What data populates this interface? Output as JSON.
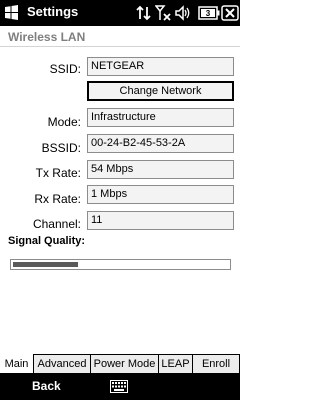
{
  "status_bar": {
    "title": "Settings",
    "battery_text": "3",
    "icons": [
      "windows-start-icon",
      "data-connectivity-icon",
      "signal-strength-icon",
      "volume-icon",
      "battery-icon",
      "close-icon"
    ]
  },
  "page": {
    "heading": "Wireless LAN"
  },
  "fields": {
    "ssid": {
      "label": "SSID:",
      "value": "NETGEAR"
    },
    "change_network_label": "Change Network",
    "mode": {
      "label": "Mode:",
      "value": "Infrastructure"
    },
    "bssid": {
      "label": "BSSID:",
      "value": "00-24-B2-45-53-2A"
    },
    "tx_rate": {
      "label": "Tx Rate:",
      "value": "54 Mbps"
    },
    "rx_rate": {
      "label": "Rx Rate:",
      "value": "1 Mbps"
    },
    "channel": {
      "label": "Channel:",
      "value": "11"
    }
  },
  "signal": {
    "label": "Signal Quality:",
    "level_fraction": 0.3
  },
  "tabs": [
    {
      "label": "Main",
      "active": true
    },
    {
      "label": "Advanced",
      "active": false
    },
    {
      "label": "Power Mode",
      "active": false
    },
    {
      "label": "LEAP",
      "active": false
    },
    {
      "label": "Enroll",
      "active": false
    }
  ],
  "softkeys": {
    "left": "Back",
    "center_icon": "keyboard-icon"
  },
  "colors": {
    "bar_background": "#000000",
    "field_background": "#f3f3f3",
    "heading_grey": "#7f7f7f",
    "signal_fill": "#5a5a5a"
  }
}
